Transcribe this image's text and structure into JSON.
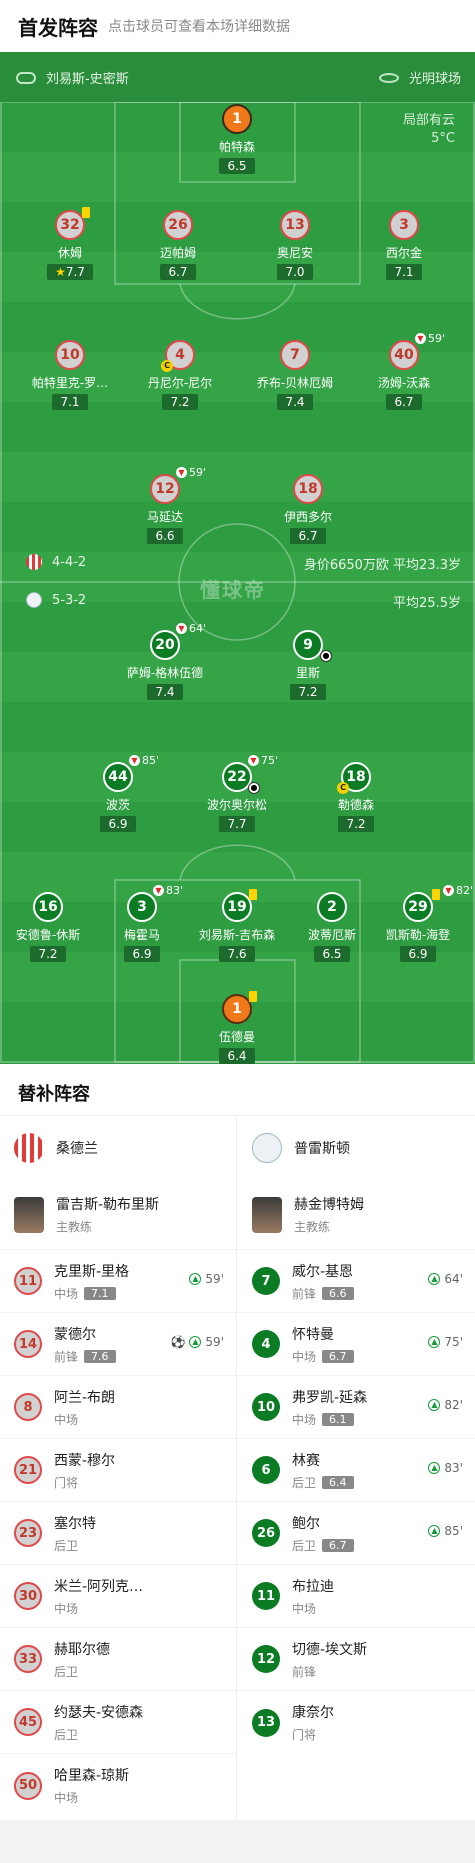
{
  "header": {
    "title": "首发阵容",
    "subtitle": "点击球员可查看本场详细数据"
  },
  "pitch": {
    "referee": "刘易斯-史密斯",
    "stadium": "光明球场",
    "weather": "局部有云",
    "temperature": "5°C",
    "watermark": "懂球帝",
    "home_formation": "4-4-2",
    "home_info": "身价6650万欧 平均23.3岁",
    "away_formation": "5-3-2",
    "away_info": "平均25.5岁"
  },
  "home_players": [
    {
      "num": "1",
      "name": "帕特森",
      "rating": "6.5"
    },
    {
      "num": "32",
      "name": "休姆",
      "rating": "7.7"
    },
    {
      "num": "26",
      "name": "迈帕姆",
      "rating": "6.7"
    },
    {
      "num": "13",
      "name": "奥尼安",
      "rating": "7.0"
    },
    {
      "num": "3",
      "name": "西尔金",
      "rating": "7.1"
    },
    {
      "num": "10",
      "name": "帕特里克-罗…",
      "rating": "7.1"
    },
    {
      "num": "4",
      "name": "丹尼尔-尼尔",
      "rating": "7.2"
    },
    {
      "num": "7",
      "name": "乔布-贝林厄姆",
      "rating": "7.4"
    },
    {
      "num": "40",
      "name": "汤姆-沃森",
      "rating": "6.7",
      "sub": "59'"
    },
    {
      "num": "12",
      "name": "马延达",
      "rating": "6.6",
      "sub": "59'"
    },
    {
      "num": "18",
      "name": "伊西多尔",
      "rating": "6.7"
    }
  ],
  "away_players": [
    {
      "num": "20",
      "name": "萨姆-格林伍德",
      "rating": "7.4",
      "sub": "64'"
    },
    {
      "num": "9",
      "name": "里斯",
      "rating": "7.2"
    },
    {
      "num": "44",
      "name": "波茨",
      "rating": "6.9",
      "sub": "85'"
    },
    {
      "num": "22",
      "name": "波尔奥尔松",
      "rating": "7.7",
      "sub": "75'"
    },
    {
      "num": "18",
      "name": "勒德森",
      "rating": "7.2"
    },
    {
      "num": "16",
      "name": "安德鲁-休斯",
      "rating": "7.2"
    },
    {
      "num": "3",
      "name": "梅霍马",
      "rating": "6.9",
      "sub": "83'"
    },
    {
      "num": "19",
      "name": "刘易斯-吉布森",
      "rating": "7.6"
    },
    {
      "num": "2",
      "name": "波蒂厄斯",
      "rating": "6.5"
    },
    {
      "num": "29",
      "name": "凯斯勒-海登",
      "rating": "6.9",
      "sub": "82'"
    },
    {
      "num": "1",
      "name": "伍德曼",
      "rating": "6.4"
    }
  ],
  "subs": {
    "title": "替补阵容",
    "home": {
      "team": "桑德兰",
      "coach": "雷吉斯-勒布里斯",
      "coach_role": "主教练",
      "players": [
        {
          "num": "11",
          "name": "克里斯-里格",
          "pos": "中场",
          "rating": "7.1",
          "min": "59'"
        },
        {
          "num": "14",
          "name": "蒙德尔",
          "pos": "前锋",
          "rating": "7.6",
          "min": "59'"
        },
        {
          "num": "8",
          "name": "阿兰-布朗",
          "pos": "中场"
        },
        {
          "num": "21",
          "name": "西蒙-穆尔",
          "pos": "门将"
        },
        {
          "num": "23",
          "name": "塞尔特",
          "pos": "后卫"
        },
        {
          "num": "30",
          "name": "米兰-阿列克…",
          "pos": "中场"
        },
        {
          "num": "33",
          "name": "赫耶尔德",
          "pos": "后卫"
        },
        {
          "num": "45",
          "name": "约瑟夫-安德森",
          "pos": "后卫"
        },
        {
          "num": "50",
          "name": "哈里森-琼斯",
          "pos": "中场"
        }
      ]
    },
    "away": {
      "team": "普雷斯顿",
      "coach": "赫金博特姆",
      "coach_role": "主教练",
      "players": [
        {
          "num": "7",
          "name": "威尔-基恩",
          "pos": "前锋",
          "rating": "6.6",
          "min": "64'"
        },
        {
          "num": "4",
          "name": "怀特曼",
          "pos": "中场",
          "rating": "6.7",
          "min": "75'"
        },
        {
          "num": "10",
          "name": "弗罗凯-延森",
          "pos": "中场",
          "rating": "6.1",
          "min": "82'"
        },
        {
          "num": "6",
          "name": "林赛",
          "pos": "后卫",
          "rating": "6.4",
          "min": "83'"
        },
        {
          "num": "26",
          "name": "鲍尔",
          "pos": "后卫",
          "rating": "6.7",
          "min": "85'"
        },
        {
          "num": "11",
          "name": "布拉迪",
          "pos": "中场"
        },
        {
          "num": "12",
          "name": "切德-埃文斯",
          "pos": "前锋"
        },
        {
          "num": "13",
          "name": "康奈尔",
          "pos": "门将"
        }
      ]
    }
  },
  "colors": {
    "pitch": "#2e9c41",
    "home_ring": "#e0484a",
    "away_fill": "#0b7b24",
    "gk": "#f07a1a"
  }
}
